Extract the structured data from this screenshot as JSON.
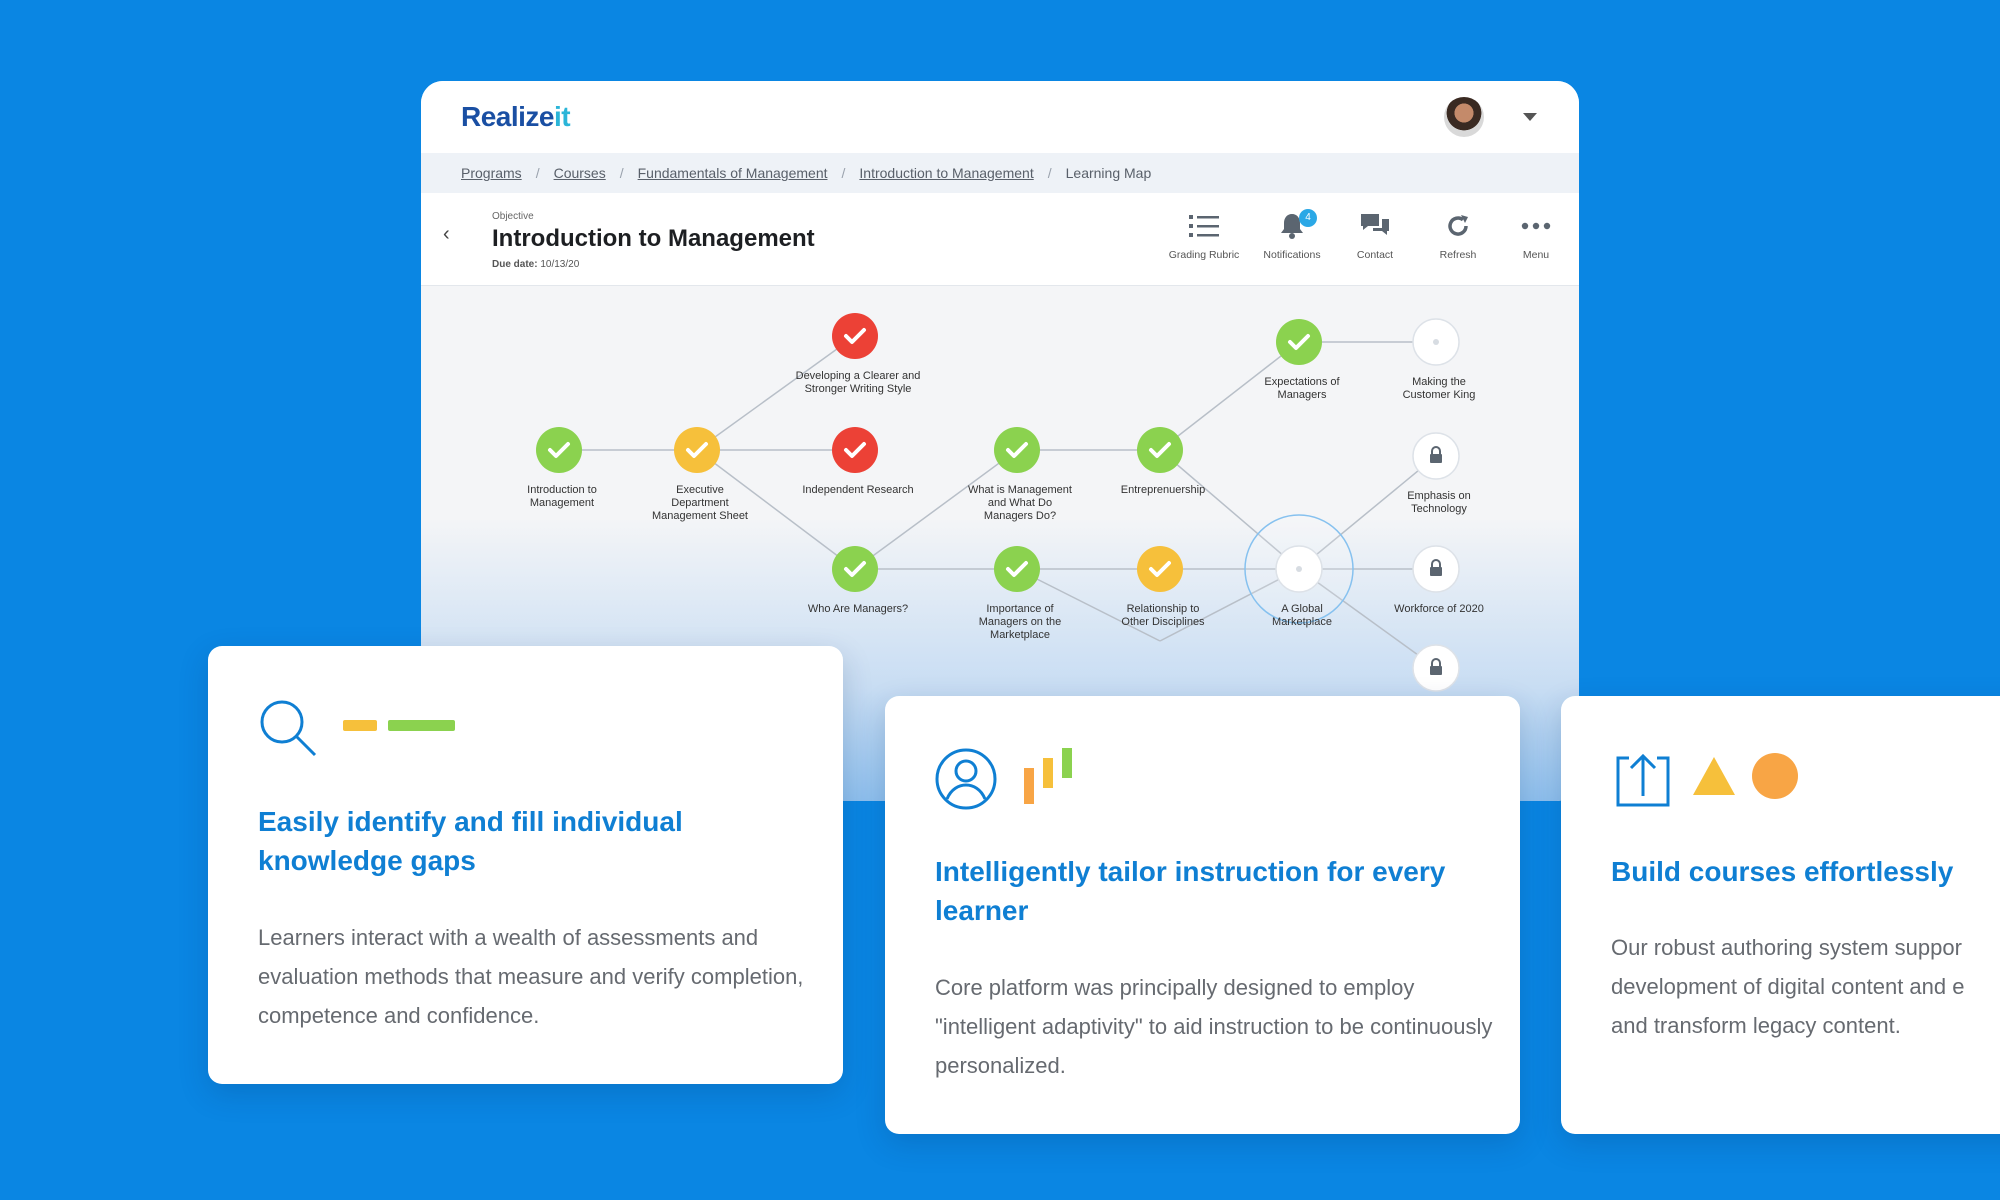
{
  "app": {
    "logo_text": "Realize",
    "logo_suffix": "it",
    "breadcrumb": [
      "Programs",
      "Courses",
      "Fundamentals of Management",
      "Introduction to Management"
    ],
    "breadcrumb_current": "Learning Map",
    "objective_label": "Objective",
    "title": "Introduction to Management",
    "due_label": "Due date:",
    "due_value": "10/13/20",
    "toolbar": {
      "grading_rubric": "Grading Rubric",
      "notifications": "Notifications",
      "notifications_count": "4",
      "contact": "Contact",
      "refresh": "Refresh",
      "menu": "Menu"
    }
  },
  "map": {
    "colors": {
      "green": "#8bd24f",
      "yellow": "#f6c03b",
      "red": "#ec4136",
      "locked": "#ffffff",
      "open": "#ffffff"
    },
    "nodes": {
      "n1": [
        "Introduction to",
        "Management"
      ],
      "n2": [
        "Executive",
        "Department",
        "Management Sheet"
      ],
      "n3": [
        "Developing a Clearer and",
        "Stronger Writing Style"
      ],
      "n4": [
        "Independent Research"
      ],
      "n5": [
        "Who Are Managers?"
      ],
      "n6": [
        "What is Management",
        "and What Do",
        "Managers Do?"
      ],
      "n7": [
        "Importance of",
        "Managers on the",
        "Marketplace"
      ],
      "n8": [
        "Entreprenuership"
      ],
      "n9": [
        "Relationship to",
        "Other Disciplines"
      ],
      "n10": [
        "Expectations of",
        "Managers"
      ],
      "n11": [
        "A Global",
        "Marketplace"
      ],
      "n12": [
        "Making the",
        "Customer King"
      ],
      "n13": [
        "Emphasis on",
        "Technology"
      ],
      "n14": [
        "Workforce of 2020"
      ]
    }
  },
  "cards": [
    {
      "title": "Easily identify and fill individual knowledge gaps",
      "body": "Learners interact with a wealth of assessments and evaluation methods that measure and verify completion, competence and confidence."
    },
    {
      "title": "Intelligently tailor instruction for every learner",
      "body": "Core platform was principally designed to employ \"intelligent adaptivity\" to aid instruction to be continuously personalized."
    },
    {
      "title": "Build courses effortlessly",
      "body_lines": [
        "Our robust authoring system suppor",
        "development of digital content and e",
        "and transform legacy content."
      ]
    }
  ],
  "accent_colors": {
    "blue": "#0f7fd3",
    "yellow": "#f6c03b",
    "green": "#8bd24f",
    "orange": "#f8a545"
  }
}
